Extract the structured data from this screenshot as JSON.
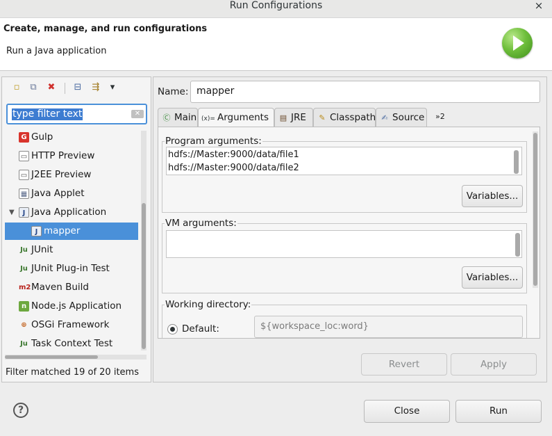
{
  "window": {
    "title": "Run Configurations",
    "close": "×"
  },
  "header": {
    "title": "Create, manage, and run configurations",
    "subtitle": "Run a Java application",
    "icon": "run-icon"
  },
  "left": {
    "toolbar": [
      {
        "name": "new-configuration-icon",
        "glyph": "▫"
      },
      {
        "name": "duplicate-icon",
        "glyph": "⧉"
      },
      {
        "name": "delete-icon",
        "glyph": "✖"
      },
      {
        "name": "collapse-all-icon",
        "glyph": "⊟"
      },
      {
        "name": "filter-icon",
        "glyph": "⇶"
      },
      {
        "name": "dropdown-icon",
        "glyph": "▾"
      }
    ],
    "filter": {
      "text": "type filter text"
    },
    "tree": [
      {
        "label": "Gulp",
        "icon": "G",
        "icon_bg": "#d8342c",
        "icon_fg": "#ffffff",
        "indent": 0
      },
      {
        "label": "HTTP Preview",
        "icon": "▭",
        "icon_bg": "#ffffff",
        "icon_fg": "#555555",
        "indent": 0
      },
      {
        "label": "J2EE Preview",
        "icon": "▭",
        "icon_bg": "#ffffff",
        "icon_fg": "#555555",
        "indent": 0
      },
      {
        "label": "Java Applet",
        "icon": "▦",
        "icon_bg": "#ffffff",
        "icon_fg": "#5a6a8a",
        "indent": 0
      },
      {
        "label": "Java Application",
        "icon": "J",
        "icon_bg": "#e9eef6",
        "icon_fg": "#2a4a8a",
        "indent": 0,
        "expanded": "▼"
      },
      {
        "label": "mapper",
        "icon": "J",
        "icon_bg": "#e9eef6",
        "icon_fg": "#2a4a8a",
        "indent": 1,
        "selected": true
      },
      {
        "label": "JUnit",
        "icon": "Ju",
        "icon_bg": "transparent",
        "icon_fg": "#3f7a32",
        "indent": 0
      },
      {
        "label": "JUnit Plug-in Test",
        "icon": "Ju",
        "icon_bg": "transparent",
        "icon_fg": "#3f7a32",
        "indent": 0
      },
      {
        "label": "Maven Build",
        "icon": "m2",
        "icon_bg": "transparent",
        "icon_fg": "#b8231c",
        "indent": 0
      },
      {
        "label": "Node.js Application",
        "icon": "n",
        "icon_bg": "#6da83f",
        "icon_fg": "#ffffff",
        "indent": 0
      },
      {
        "label": "OSGi Framework",
        "icon": "⊕",
        "icon_bg": "transparent",
        "icon_fg": "#c56a2a",
        "indent": 0
      },
      {
        "label": "Task Context Test",
        "icon": "Ju",
        "icon_bg": "transparent",
        "icon_fg": "#3f7a32",
        "indent": 0
      }
    ],
    "status": "Filter matched 19 of 20 items"
  },
  "right": {
    "name_label": "Name:",
    "name_value": "mapper",
    "tabs": [
      {
        "label": "Main",
        "icon": "Ⓒ",
        "icon_color": "#3a8a3a",
        "active": false
      },
      {
        "label": "Arguments",
        "icon": "(x)=",
        "icon_color": "#2e3436",
        "active": true
      },
      {
        "label": "JRE",
        "icon": "▤",
        "icon_color": "#6a4a2a",
        "active": false
      },
      {
        "label": "Classpath",
        "icon": "✎",
        "icon_color": "#b88a1a",
        "active": false
      },
      {
        "label": "Source",
        "icon": "✍",
        "icon_color": "#4a6aa0",
        "active": false
      }
    ],
    "tabs_more": "»2",
    "program_arguments": {
      "title": "Program arguments:",
      "lines": [
        "hdfs://Master:9000/data/file1",
        "hdfs://Master:9000/data/file2"
      ],
      "variables": "Variables..."
    },
    "vm_arguments": {
      "title": "VM arguments:",
      "value": "",
      "variables": "Variables..."
    },
    "working_directory": {
      "title": "Working directory:",
      "default_label": "Default:",
      "default_value": "${workspace_loc:word}"
    },
    "revert": "Revert",
    "apply": "Apply"
  },
  "footer": {
    "help": "?",
    "close": "Close",
    "run": "Run"
  }
}
